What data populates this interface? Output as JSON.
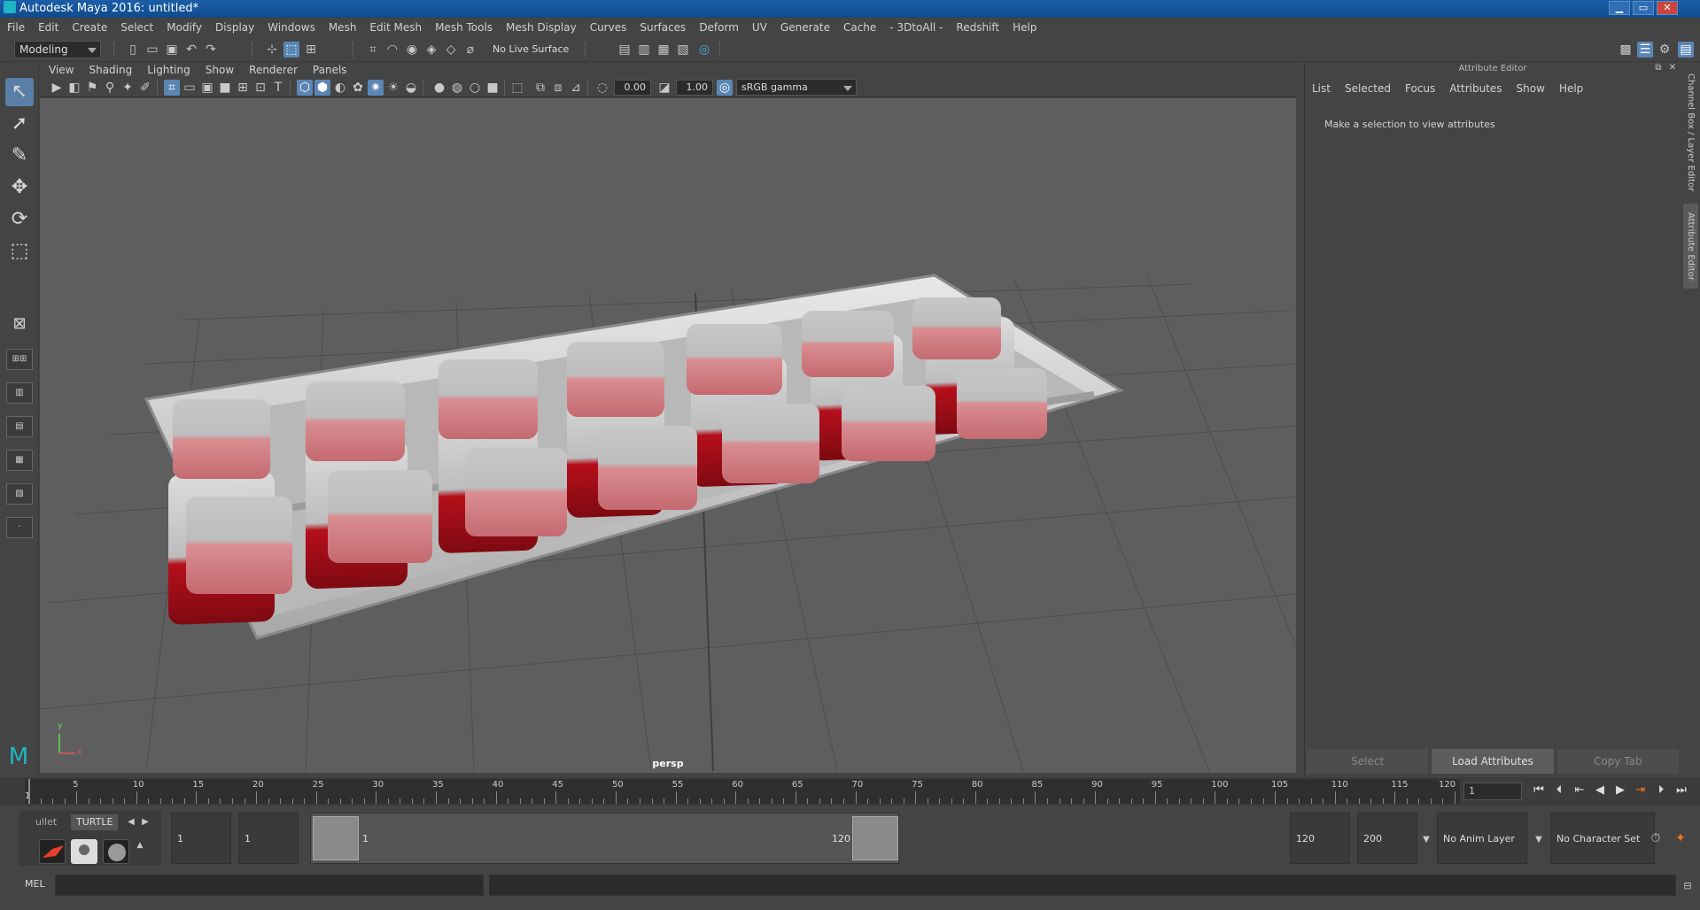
{
  "window": {
    "title": "Autodesk Maya 2016: untitled*",
    "controls": [
      "▁",
      "▭",
      "✕"
    ]
  },
  "menu": [
    "File",
    "Edit",
    "Create",
    "Select",
    "Modify",
    "Display",
    "Windows",
    "Mesh",
    "Edit Mesh",
    "Mesh Tools",
    "Mesh Display",
    "Curves",
    "Surfaces",
    "Deform",
    "UV",
    "Generate",
    "Cache",
    "- 3DtoAll -",
    "Redshift",
    "Help"
  ],
  "status": {
    "mode": "Modeling",
    "live_surface": "No Live Surface"
  },
  "viewport": {
    "menu": [
      "View",
      "Shading",
      "Lighting",
      "Show",
      "Renderer",
      "Panels"
    ],
    "exposure": "0.00",
    "gamma": "1.00",
    "colorspace": "sRGB gamma",
    "camera": "persp",
    "axis_x": "x",
    "axis_y": "y"
  },
  "attribute_editor": {
    "title": "Attribute Editor",
    "menu": [
      "List",
      "Selected",
      "Focus",
      "Attributes",
      "Show",
      "Help"
    ],
    "message": "Make a selection to view attributes",
    "buttons": [
      "Select",
      "Load Attributes",
      "Copy Tab"
    ],
    "side_tabs": [
      "Channel Box / Layer Editor",
      "Attribute Editor"
    ]
  },
  "timeline": {
    "labels": [
      "1",
      "5",
      "10",
      "15",
      "20",
      "25",
      "30",
      "35",
      "40",
      "45",
      "50",
      "55",
      "60",
      "65",
      "70",
      "75",
      "80",
      "85",
      "90",
      "95",
      "100",
      "105",
      "110",
      "115",
      "120"
    ],
    "current_frame": "1"
  },
  "range": {
    "shelf_tabs": [
      "ullet",
      "TURTLE"
    ],
    "start": "1",
    "playback_start": "1",
    "slider_start": "1",
    "slider_end": "120",
    "playback_end": "120",
    "end": "200",
    "anim_layer": "No Anim Layer",
    "character_set": "No Character Set"
  },
  "command": {
    "label": "MEL"
  },
  "colors": {
    "selection": "#5a86b4",
    "tray_white": "#c9c9c9",
    "tray_red": "#b50f1a"
  }
}
